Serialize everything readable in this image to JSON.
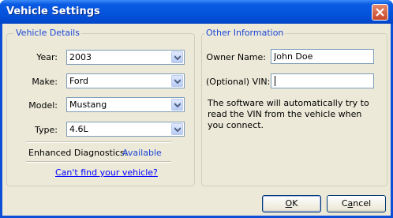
{
  "window": {
    "title": "Vehicle Settings"
  },
  "vehicle_details": {
    "legend": "Vehicle Details",
    "year": {
      "label": "Year:",
      "value": "2003"
    },
    "make": {
      "label": "Make:",
      "value": "Ford"
    },
    "model": {
      "label": "Model:",
      "value": "Mustang"
    },
    "type": {
      "label": "Type:",
      "value": "4.6L"
    },
    "enhanced_label": "Enhanced Diagnostics:",
    "enhanced_value": "Available",
    "cant_find_link": "Can't find your vehicle?"
  },
  "other_information": {
    "legend": "Other Information",
    "owner_name": {
      "label": "Owner Name:",
      "value": "John Doe"
    },
    "vin": {
      "label": "(Optional) VIN:",
      "value": ""
    },
    "info_text": "The software will automatically try to read the VIN from the vehicle when you connect."
  },
  "buttons": {
    "ok_mnemonic": "O",
    "ok_rest": "K",
    "cancel_first": "C",
    "cancel_mnemonic": "a",
    "cancel_rest": "ncel"
  },
  "colors": {
    "title_bar": "#0553dc",
    "dialog_bg": "#ece9d8",
    "accent_text": "#1c46d6",
    "link": "#0000ff"
  }
}
